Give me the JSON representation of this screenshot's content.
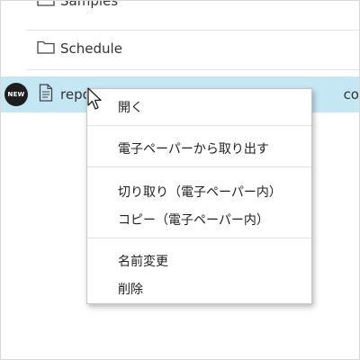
{
  "file_list": {
    "rows": [
      {
        "label": "Samples",
        "icon": "folder-icon"
      },
      {
        "label": "Schedule",
        "icon": "folder-icon"
      },
      {
        "label": "repo",
        "icon": "document-icon",
        "badge": "NEW",
        "right_text": "co",
        "selected": true
      }
    ]
  },
  "context_menu": {
    "items": [
      {
        "label": "開く"
      },
      {
        "label": "電子ペーパーから取り出す"
      },
      {
        "label": "切り取り（電子ペーパー内）"
      },
      {
        "label": "コピー（電子ペーパー内）"
      },
      {
        "label": "名前変更"
      },
      {
        "label": "削除"
      }
    ]
  },
  "colors": {
    "selected_row": "#c5e7f4",
    "badge_bg": "#1e1e1e"
  }
}
